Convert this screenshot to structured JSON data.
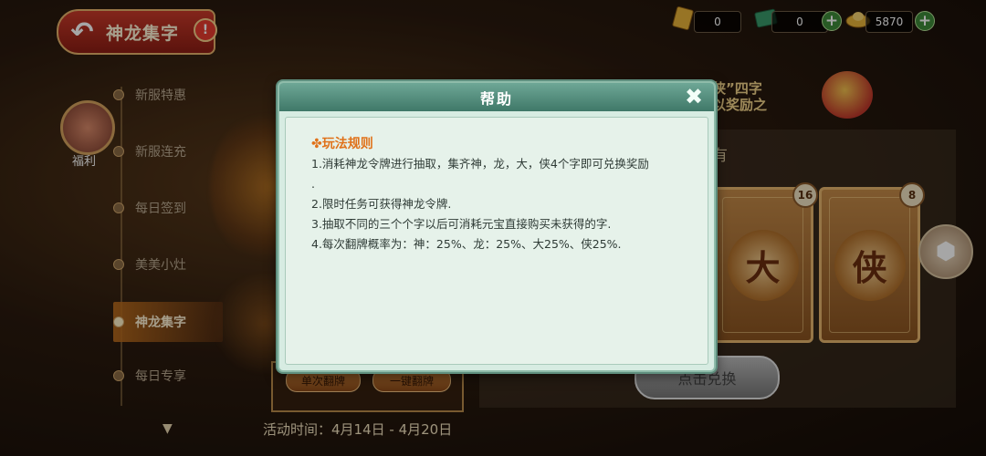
{
  "header": {
    "back_title": "神龙集字",
    "info_badge": "!"
  },
  "resources": [
    {
      "name": "token-card",
      "value": "0"
    },
    {
      "name": "cash",
      "value": "0"
    },
    {
      "name": "ingot",
      "value": "5870"
    }
  ],
  "sidebar": {
    "welfare_label": "福利",
    "items": [
      {
        "label": "新服特惠"
      },
      {
        "label": "新服连充"
      },
      {
        "label": "每日签到"
      },
      {
        "label": "美美小灶"
      },
      {
        "label": "神龙集字"
      },
      {
        "label": "每日专享"
      }
    ]
  },
  "background": {
    "prize_text_line1": "侠”四字",
    "prize_text_line2": "以奖励之",
    "have_label": "有",
    "cards": [
      {
        "char": "大",
        "count": "16"
      },
      {
        "char": "侠",
        "count": "8"
      }
    ],
    "exchange_button": "点击兑换",
    "single_flip": "单次翻牌",
    "one_key_flip": "一键翻牌",
    "activity_time": "活动时间：4月14日 - 4月20日"
  },
  "modal": {
    "title": "帮助",
    "rules_heading": "✤玩法规则",
    "rules": [
      "1.消耗神龙令牌进行抽取，集齐神，龙，大，侠4个字即可兑换奖励",
      ".",
      "2.限时任务可获得神龙令牌.",
      "3.抽取不同的三个个字以后可消耗元宝直接购买未获得的字.",
      "4.每次翻牌概率为：神：25%、龙：25%、大25%、侠25%."
    ]
  },
  "colors": {
    "accent_orange": "#e0721a",
    "modal_header": "#3f7868",
    "active_nav": "#be6e1e"
  }
}
